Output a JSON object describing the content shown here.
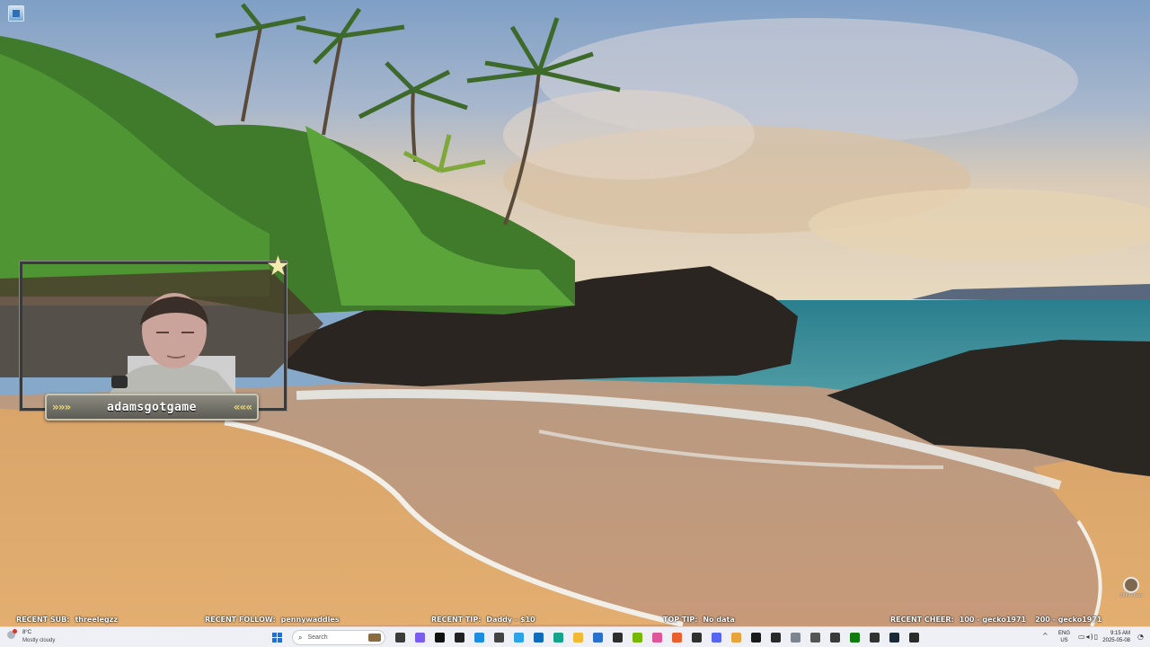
{
  "overlay": {
    "webcam_name": "adamsgotgame",
    "chevrons_left": "»»»",
    "chevrons_right": "«««"
  },
  "stream_bar": {
    "recent_sub_label": "RECENT SUB:",
    "recent_sub_value": "threelegzz",
    "recent_follow_label": "RECENT FOLLOW:",
    "recent_follow_value": "pennywaddles",
    "recent_tip_label": "RECENT TIP:",
    "recent_tip_value": "Daddy - $10",
    "top_tip_label": "TOP TIP:",
    "top_tip_value": "No data",
    "recent_cheer_label": "RECENT CHEER:",
    "recent_cheer_value_1": "100 - gecko1971",
    "recent_cheer_value_2": "200 - gecko1971"
  },
  "corner_logo_text": "Chill Vibes",
  "taskbar": {
    "weather_temp": "8°C",
    "weather_condition": "Mostly cloudy",
    "search_placeholder": "Search",
    "pinned_apps": [
      {
        "name": "task-view-icon",
        "color": "#3b3b3b"
      },
      {
        "name": "copilot-icon",
        "color": "#7b5cf0"
      },
      {
        "name": "tiktok-icon",
        "color": "#111111"
      },
      {
        "name": "tiktok-studio-icon",
        "color": "#222222"
      },
      {
        "name": "edge-blue-icon",
        "color": "#1d8de0"
      },
      {
        "name": "app-dark-icon",
        "color": "#444444"
      },
      {
        "name": "photos-icon",
        "color": "#2aa3e8"
      },
      {
        "name": "outlook-icon",
        "color": "#0f6cbd"
      },
      {
        "name": "edge-icon",
        "color": "#14a38b"
      },
      {
        "name": "file-explorer-icon",
        "color": "#f2b932"
      },
      {
        "name": "store-icon",
        "color": "#2b6fcf"
      },
      {
        "name": "terminal-icon",
        "color": "#2e2e2e"
      },
      {
        "name": "nvidia-icon",
        "color": "#76b900"
      },
      {
        "name": "app-pink-icon",
        "color": "#e0559a"
      },
      {
        "name": "app-orange-icon",
        "color": "#e8612c"
      },
      {
        "name": "obs-icon",
        "color": "#303030"
      },
      {
        "name": "discord-icon",
        "color": "#5865f2"
      },
      {
        "name": "chrome-icon",
        "color": "#e8a33a"
      },
      {
        "name": "app-black-icon",
        "color": "#1a1a1a"
      },
      {
        "name": "app-dark-2-icon",
        "color": "#2a2a2a"
      },
      {
        "name": "settings-icon",
        "color": "#7d8590"
      },
      {
        "name": "app-mono-icon",
        "color": "#555555"
      },
      {
        "name": "capture-icon",
        "color": "#3a3a3a"
      },
      {
        "name": "xbox-icon",
        "color": "#107c10"
      },
      {
        "name": "app-dark-3-icon",
        "color": "#333333"
      },
      {
        "name": "steam-icon",
        "color": "#1b2838"
      },
      {
        "name": "app-dark-4-icon",
        "color": "#2b2b2b"
      }
    ],
    "tray_language_1": "ENG",
    "tray_language_2": "US",
    "clock_time": "9:15 AM",
    "clock_date": "2025-05-08"
  }
}
